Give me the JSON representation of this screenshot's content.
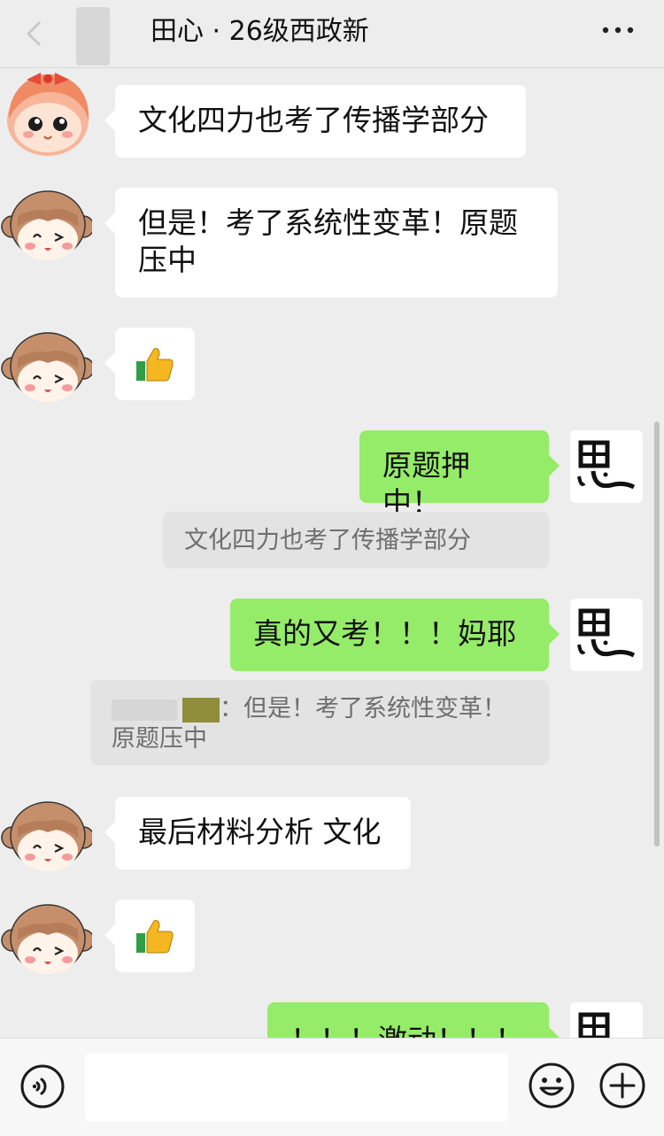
{
  "header": {
    "title": "田心 · 26级西政新",
    "back_icon": "chevron-left-icon",
    "more_icon": "more-dots-icon"
  },
  "messages": [
    {
      "side": "in",
      "avatar": "cartoon-girl-red-hair",
      "text": "文化四力也考了传播学部分"
    },
    {
      "side": "in",
      "avatar": "cartoon-girl-brown-hair",
      "text_lines": [
        "但是！考了系统性变革！原题",
        "压中"
      ]
    },
    {
      "side": "in",
      "avatar": "cartoon-girl-brown-hair",
      "emoji": "thumbs-up-icon",
      "emoji_char": "👍"
    },
    {
      "side": "out",
      "avatar": "calligraphy-si",
      "text": "原题押中！",
      "quote": "文化四力也考了传播学部分"
    },
    {
      "side": "out",
      "avatar": "calligraphy-si",
      "text": "真的又考！！！妈耶",
      "quote_lines": [
        "：但是！考了系统性变革！",
        "原题压中"
      ]
    },
    {
      "side": "in",
      "avatar": "cartoon-girl-brown-hair",
      "text": "最后材料分析 文化"
    },
    {
      "side": "in",
      "avatar": "cartoon-girl-brown-hair",
      "emoji": "thumbs-up-icon",
      "emoji_char": "👍"
    },
    {
      "side": "out",
      "avatar": "calligraphy-si",
      "text": "！！！激动！！！"
    }
  ],
  "avatar_label": "思",
  "input_bar": {
    "voice_icon": "voice-icon",
    "emoji_icon": "smiley-icon",
    "plus_icon": "plus-icon",
    "placeholder": ""
  },
  "colors": {
    "background": "#ededed",
    "outgoing_bubble": "#95ec69",
    "incoming_bubble": "#ffffff",
    "quote_bubble": "#e3e3e3"
  }
}
